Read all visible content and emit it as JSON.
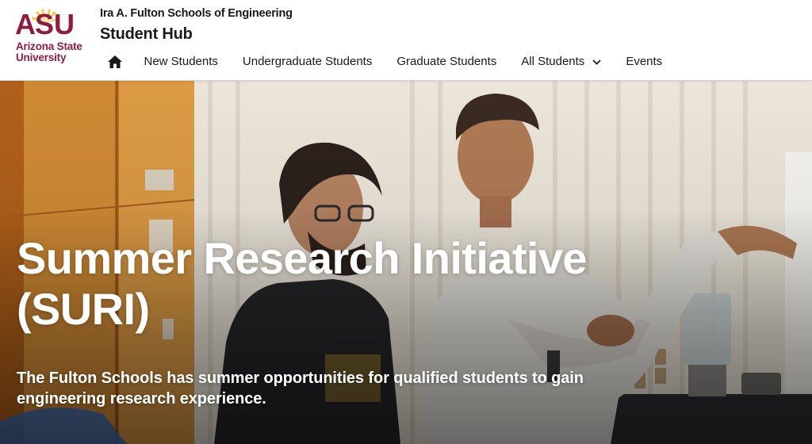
{
  "brand": {
    "logo_text": "ASU",
    "logo_line1": "Arizona State",
    "logo_line2": "University",
    "maroon": "#8c1d40",
    "gold": "#ffc627"
  },
  "header": {
    "college_name": "Ira A. Fulton Schools of Engineering",
    "site_title": "Student Hub"
  },
  "nav": {
    "home_icon": "home-icon",
    "items": [
      {
        "label": "New Students"
      },
      {
        "label": "Undergraduate Students"
      },
      {
        "label": "Graduate Students"
      },
      {
        "label": "All Students",
        "has_dropdown": true
      },
      {
        "label": "Events"
      }
    ]
  },
  "hero": {
    "title_line1": "Summer Research Initiative",
    "title_line2": "(SURI)",
    "subtitle": "The Fulton Schools has summer opportunities for qualified students to gain engineering research experience."
  }
}
